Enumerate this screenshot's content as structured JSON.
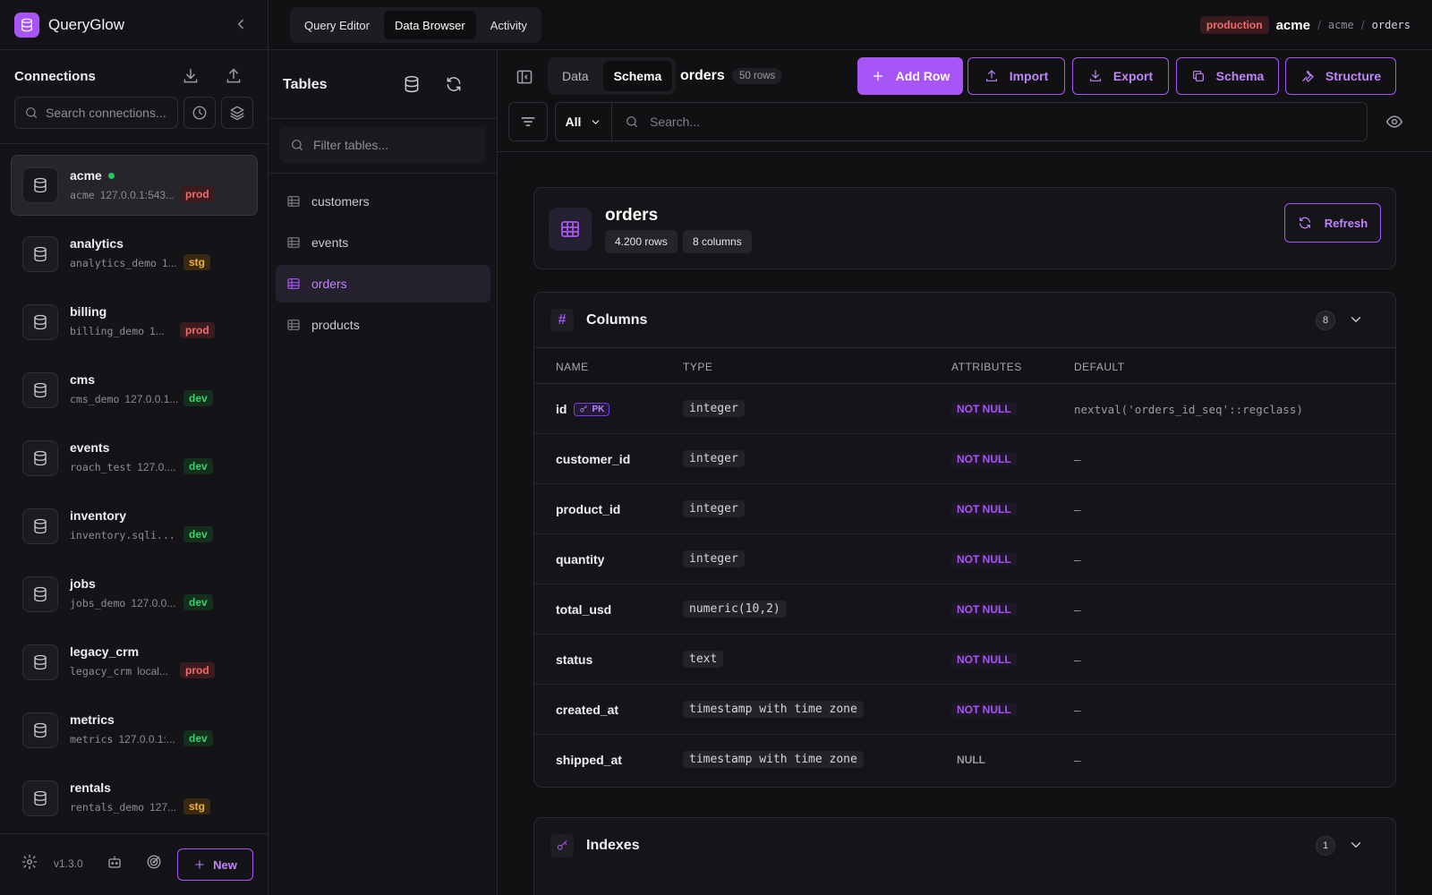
{
  "app": {
    "name": "QueryGlow",
    "version": "v1.3.0"
  },
  "colors": {
    "accent": "#a855f7",
    "prod": "#f06b6b",
    "stg": "#f0b23c",
    "dev": "#34d36a",
    "online": "#22c55e"
  },
  "sidebar": {
    "title": "Connections",
    "search_placeholder": "Search connections...",
    "new_label": "New",
    "connections": [
      {
        "name": "acme",
        "db": "acme",
        "host": "127.0.0.1:543...",
        "env": "prod",
        "active": true,
        "online": true
      },
      {
        "name": "analytics",
        "db": "analytics_demo",
        "host": "1...",
        "env": "stg"
      },
      {
        "name": "billing",
        "db": "billing_demo",
        "host": "1...",
        "env": "prod"
      },
      {
        "name": "cms",
        "db": "cms_demo",
        "host": "127.0.0.1...",
        "env": "dev"
      },
      {
        "name": "events",
        "db": "roach_test",
        "host": "127.0....",
        "env": "dev"
      },
      {
        "name": "inventory",
        "db": "inventory.sqli...",
        "host": "",
        "env": "dev"
      },
      {
        "name": "jobs",
        "db": "jobs_demo",
        "host": "127.0.0...",
        "env": "dev"
      },
      {
        "name": "legacy_crm",
        "db": "legacy_crm",
        "host": "local...",
        "env": "prod"
      },
      {
        "name": "metrics",
        "db": "metrics",
        "host": "127.0.0.1:...",
        "env": "dev"
      },
      {
        "name": "rentals",
        "db": "rentals_demo",
        "host": "127...",
        "env": "stg"
      }
    ]
  },
  "topnav": {
    "tabs": [
      {
        "label": "Query Editor",
        "active": false
      },
      {
        "label": "Data Browser",
        "active": true
      },
      {
        "label": "Activity",
        "active": false
      }
    ],
    "breadcrumb": {
      "env": "production",
      "connection": "acme",
      "database": "acme",
      "table": "orders",
      "sep": "/"
    }
  },
  "tables_panel": {
    "title": "Tables",
    "filter_placeholder": "Filter tables...",
    "items": [
      {
        "name": "customers",
        "active": false
      },
      {
        "name": "events",
        "active": false
      },
      {
        "name": "orders",
        "active": true
      },
      {
        "name": "products",
        "active": false
      }
    ]
  },
  "toolbar": {
    "view_tabs": [
      {
        "label": "Data",
        "active": false
      },
      {
        "label": "Schema",
        "active": true
      }
    ],
    "table_name": "orders",
    "rows_label": "50 rows",
    "buttons": {
      "add_row": "Add Row",
      "import": "Import",
      "export": "Export",
      "schema": "Schema",
      "structure": "Structure"
    },
    "filter_select": "All",
    "search_placeholder": "Search..."
  },
  "schema": {
    "table_name": "orders",
    "rows_chip": "4.200 rows",
    "columns_chip": "8 columns",
    "refresh_label": "Refresh",
    "columns_section": {
      "title": "Columns",
      "count": "8",
      "headers": {
        "name": "NAME",
        "type": "TYPE",
        "attributes": "ATTRIBUTES",
        "default": "DEFAULT"
      },
      "pk_label": "PK",
      "rows": [
        {
          "name": "id",
          "type": "integer",
          "attr": "NOT NULL",
          "default": "nextval('orders_id_seq'::regclass)",
          "pk": true
        },
        {
          "name": "customer_id",
          "type": "integer",
          "attr": "NOT NULL",
          "default": "–"
        },
        {
          "name": "product_id",
          "type": "integer",
          "attr": "NOT NULL",
          "default": "–"
        },
        {
          "name": "quantity",
          "type": "integer",
          "attr": "NOT NULL",
          "default": "–"
        },
        {
          "name": "total_usd",
          "type": "numeric(10,2)",
          "attr": "NOT NULL",
          "default": "–"
        },
        {
          "name": "status",
          "type": "text",
          "attr": "NOT NULL",
          "default": "–"
        },
        {
          "name": "created_at",
          "type": "timestamp with time zone",
          "attr": "NOT NULL",
          "default": "–"
        },
        {
          "name": "shipped_at",
          "type": "timestamp with time zone",
          "attr": "NULL",
          "default": "–"
        }
      ]
    },
    "indexes_section": {
      "title": "Indexes",
      "count": "1"
    }
  }
}
